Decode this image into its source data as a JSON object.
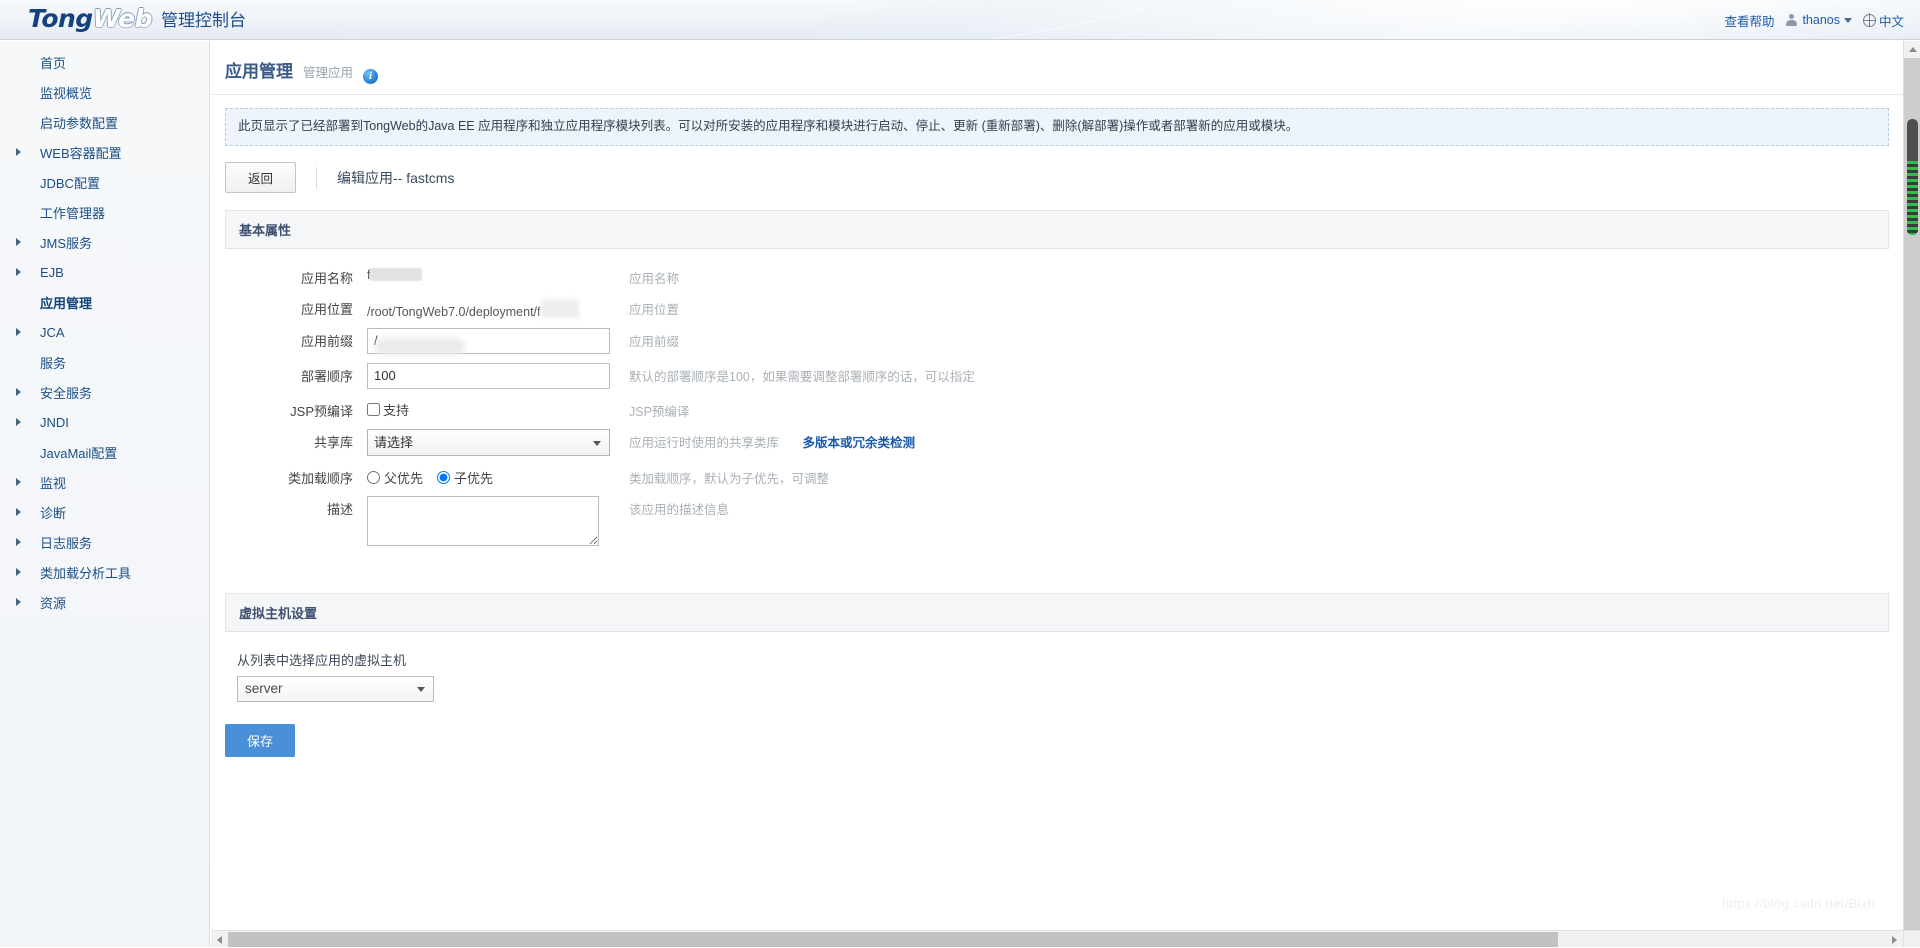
{
  "header": {
    "logo_tong": "Tong",
    "logo_web": "Web",
    "logo_suffix": "管理控制台",
    "help_link": "查看帮助",
    "username": "thanos",
    "language": "中文"
  },
  "sidebar": {
    "items": [
      {
        "label": "首页",
        "expandable": false,
        "active": false
      },
      {
        "label": "监视概览",
        "expandable": false,
        "active": false
      },
      {
        "label": "启动参数配置",
        "expandable": false,
        "active": false
      },
      {
        "label": "WEB容器配置",
        "expandable": true,
        "active": false
      },
      {
        "label": "JDBC配置",
        "expandable": false,
        "active": false
      },
      {
        "label": "工作管理器",
        "expandable": false,
        "active": false
      },
      {
        "label": "JMS服务",
        "expandable": true,
        "active": false
      },
      {
        "label": "EJB",
        "expandable": true,
        "active": false
      },
      {
        "label": "应用管理",
        "expandable": false,
        "active": true
      },
      {
        "label": "JCA",
        "expandable": true,
        "active": false
      },
      {
        "label": "服务",
        "expandable": false,
        "active": false
      },
      {
        "label": "安全服务",
        "expandable": true,
        "active": false
      },
      {
        "label": "JNDI",
        "expandable": true,
        "active": false
      },
      {
        "label": "JavaMail配置",
        "expandable": false,
        "active": false
      },
      {
        "label": "监视",
        "expandable": true,
        "active": false
      },
      {
        "label": "诊断",
        "expandable": true,
        "active": false
      },
      {
        "label": "日志服务",
        "expandable": true,
        "active": false
      },
      {
        "label": "类加载分析工具",
        "expandable": true,
        "active": false
      },
      {
        "label": "资源",
        "expandable": true,
        "active": false
      }
    ]
  },
  "page": {
    "title": "应用管理",
    "subtitle": "管理应用",
    "notice": "此页显示了已经部署到TongWeb的Java EE 应用程序和独立应用程序模块列表。可以对所安装的应用程序和模块进行启动、停止、更新 (重新部署)、删除(解部署)操作或者部署新的应用或模块。",
    "back_button": "返回",
    "edit_title": "编辑应用-- fastcms"
  },
  "basic_panel": {
    "heading": "基本属性",
    "fields": {
      "app_name": {
        "label": "应用名称",
        "value": "f",
        "hint": "应用名称"
      },
      "app_path": {
        "label": "应用位置",
        "value": "/root/TongWeb7.0/deployment/f",
        "hint": "应用位置"
      },
      "app_prefix": {
        "label": "应用前缀",
        "value": "/",
        "hint": "应用前缀"
      },
      "deploy_order": {
        "label": "部署顺序",
        "value": "100",
        "hint": "默认的部署顺序是100，如果需要调整部署顺序的话，可以指定"
      },
      "jsp_precompile": {
        "label": "JSP预编译",
        "checkbox_label": "支持",
        "checked": false,
        "hint": "JSP预编译"
      },
      "shared_lib": {
        "label": "共享库",
        "selected": "请选择",
        "options": [
          "请选择"
        ],
        "hint": "应用运行时使用的共享类库",
        "link": "多版本或冗余类检测"
      },
      "class_load_order": {
        "label": "类加载顺序",
        "options": [
          {
            "label": "父优先",
            "selected": false
          },
          {
            "label": "子优先",
            "selected": true
          }
        ],
        "hint": "类加载顺序，默认为子优先，可调整"
      },
      "description": {
        "label": "描述",
        "value": "",
        "hint": "该应用的描述信息"
      }
    }
  },
  "vhost_panel": {
    "heading": "虚拟主机设置",
    "label": "从列表中选择应用的虚拟主机",
    "selected": "server",
    "options": [
      "server"
    ]
  },
  "actions": {
    "save": "保存"
  },
  "watermark": "https://blog.csdn.net/Bixh",
  "colors": {
    "accent": "#4a90d9",
    "link": "#1c5ca8",
    "title": "#3b5a86",
    "notice_bg": "#eef4fb",
    "panel_head_bg": "#f5f6f8"
  }
}
